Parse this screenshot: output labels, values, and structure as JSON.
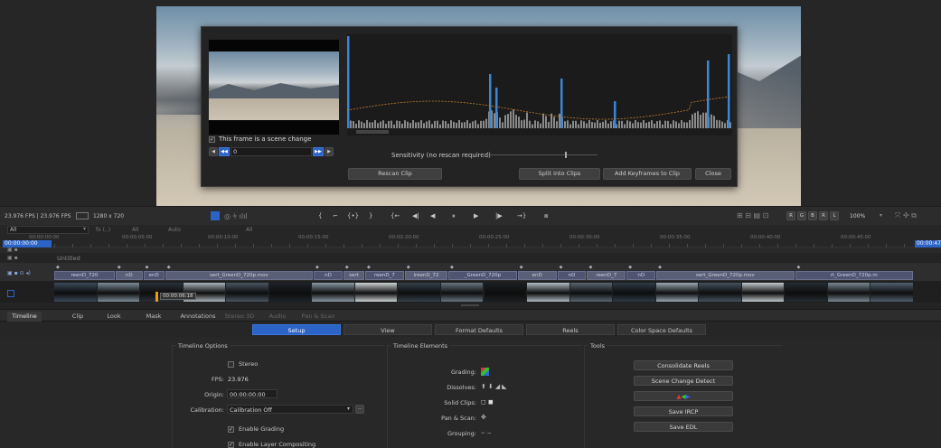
{
  "dialog": {
    "checkbox_label": "This frame is a scene change",
    "frame_value": "0",
    "sensitivity_label": "Sensitivity (no rescan required)",
    "buttons": {
      "rescan": "Rescan Clip",
      "split": "Split into Clips",
      "add_keyframes": "Add Keyframes to Clip",
      "close": "Close"
    }
  },
  "toolbar": {
    "fps_info": "23.976 FPS | 23.976 FPS",
    "resolution": "1280 x 720",
    "zoom": "100%",
    "channels": [
      "R",
      "G",
      "B",
      "R",
      "L"
    ],
    "all_label": "All",
    "auto_label": "Auto",
    "all2_label": "All"
  },
  "ruler": {
    "current_tc": "00:00:00:00",
    "end_tc": "00:00:47:",
    "ticks": [
      "00:00:00:00",
      "00:00:05:00",
      "00:00:10:00",
      "00:00:15:00",
      "00:00:20:00",
      "00:00:25:00",
      "00:00:30:00",
      "00:00:35:00",
      "00:00:40:00",
      "00:00:45:00"
    ]
  },
  "timeline": {
    "track_name": "Untitled",
    "playhead_tc": "00:00:06:18",
    "clip_labels": [
      "reenD_720",
      "nD",
      "enD",
      "sert_GreenD_720p.mov",
      "nD",
      "sert",
      "reenD_7",
      "ireenD_72",
      "_GreenD_720p",
      "enD",
      "nD",
      "reenD_7",
      "nD",
      "sert_GreenD_720p.mov",
      "rt_GreenD_720p.m"
    ]
  },
  "main_tabs": [
    {
      "label": "Timeline",
      "active": true,
      "dim": false
    },
    {
      "label": "Clip",
      "active": false,
      "dim": false
    },
    {
      "label": "Look",
      "active": false,
      "dim": false
    },
    {
      "label": "Mask",
      "active": false,
      "dim": false
    },
    {
      "label": "Annotations",
      "active": false,
      "dim": false
    },
    {
      "label": "Stereo 3D",
      "active": false,
      "dim": true
    },
    {
      "label": "Audio",
      "active": false,
      "dim": true
    },
    {
      "label": "Pan & Scan",
      "active": false,
      "dim": true
    }
  ],
  "sub_tabs": [
    {
      "label": "Setup",
      "active": true
    },
    {
      "label": "View",
      "active": false
    },
    {
      "label": "Format Defaults",
      "active": false
    },
    {
      "label": "Reels",
      "active": false
    },
    {
      "label": "Color Space Defaults",
      "active": false
    }
  ],
  "timeline_options": {
    "title": "Timeline Options",
    "stereo_label": "Stereo",
    "fps_label": "FPS:",
    "fps_value": "23.976",
    "origin_label": "Origin:",
    "origin_value": "00:00:00:00",
    "calibration_label": "Calibration:",
    "calibration_value": "Calibration Off",
    "enable_grading": "Enable Grading",
    "enable_layer": "Enable Layer Compositing"
  },
  "timeline_elements": {
    "title": "Timeline Elements",
    "grading": "Grading:",
    "dissolves": "Dissolves:",
    "solid_clips": "Solid Clips:",
    "pan_scan": "Pan & Scan:",
    "grouping": "Grouping:"
  },
  "tools": {
    "title": "Tools",
    "buttons": [
      "Consolidate Reels",
      "Scene Change Detect",
      "",
      "Save IRCP",
      "Save EDL"
    ]
  }
}
